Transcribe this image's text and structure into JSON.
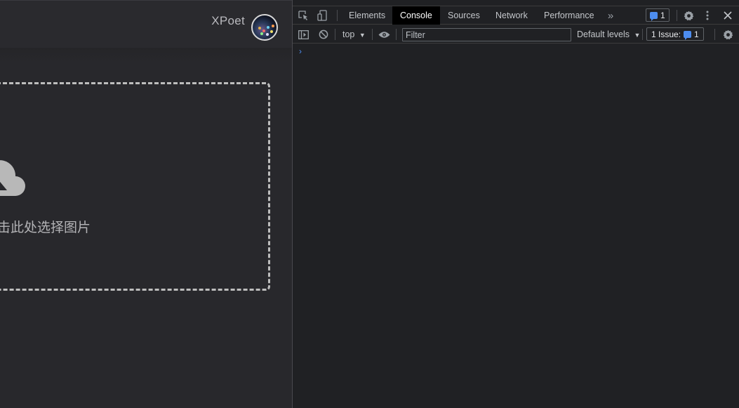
{
  "app": {
    "username": "XPoet",
    "drop_text": "击此处选择图片",
    "accent": "#bdbdbd"
  },
  "devtools": {
    "tabs": [
      "Elements",
      "Console",
      "Sources",
      "Network",
      "Performance"
    ],
    "active_tab": "Console",
    "more_tabs_glyph": "»",
    "messages_badge": "1",
    "context": "top",
    "filter_placeholder": "Filter",
    "levels": "Default levels",
    "issues_label": "1 Issue:",
    "issues_count": "1",
    "prompt_glyph": "›",
    "accent": "#4d8df0"
  },
  "icons": [
    "inspect-element-icon",
    "device-toolbar-icon",
    "more-tabs-icon",
    "message-icon",
    "settings-icon",
    "kebab-menu-icon",
    "close-icon",
    "sidebar-toggle-icon",
    "clear-console-icon",
    "eye-icon",
    "cloud-upload-icon"
  ]
}
